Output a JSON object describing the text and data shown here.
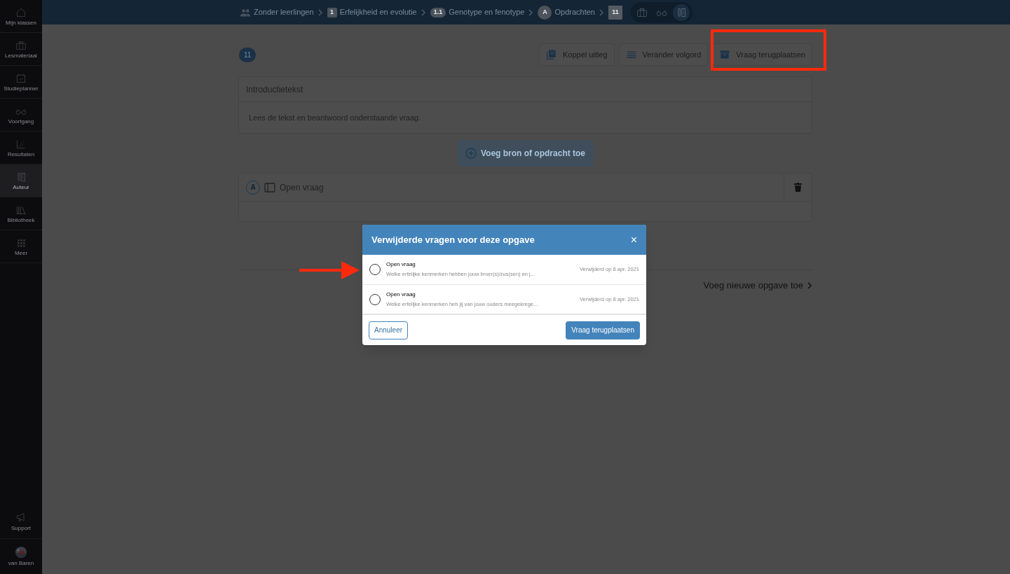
{
  "sidebar": {
    "items": [
      {
        "kind": "home",
        "label": "Mijn klassen",
        "selected": false
      },
      {
        "kind": "case",
        "label": "Lesmateriaal",
        "selected": false
      },
      {
        "kind": "calendar",
        "label": "Studieplanner",
        "selected": false
      },
      {
        "kind": "glasses",
        "label": "Voortgang",
        "selected": false
      },
      {
        "kind": "chart",
        "label": "Resultaten",
        "selected": false
      },
      {
        "kind": "author",
        "label": "Auteur",
        "selected": true
      },
      {
        "kind": "books",
        "label": "Bibliotheek",
        "selected": false
      },
      {
        "kind": "grid",
        "label": "Meer",
        "selected": false
      }
    ],
    "bottom_items": [
      {
        "kind": "megaphone",
        "label": "Support"
      },
      {
        "kind": "avatar",
        "label": "van Baren"
      }
    ]
  },
  "breadcrumb": [
    {
      "kind": "people",
      "label": "Zonder leerlingen"
    },
    {
      "kind": "square",
      "badge": "1",
      "label": "Erfelijkheid en evolutie"
    },
    {
      "kind": "pill",
      "badge": "1.1",
      "label": "Genotype en fenotype"
    },
    {
      "kind": "circle",
      "badge": "A",
      "label": "Opdrachten"
    },
    {
      "kind": "square",
      "badge": "11"
    }
  ],
  "view_toggles": [
    {
      "kind": "case",
      "selected": false
    },
    {
      "kind": "glasses",
      "selected": false
    },
    {
      "kind": "author",
      "selected": true
    }
  ],
  "page": {
    "count": "11",
    "toolbar": [
      {
        "kind": "book",
        "label": "Koppel uitleg"
      },
      {
        "kind": "list",
        "label": "Verander volgord"
      },
      {
        "kind": "archive",
        "label": "Vraag terugplaatsen"
      }
    ],
    "intro": {
      "title": "Introductietekst",
      "text": "Lees de tekst en beantwoord onderstaande vraag."
    },
    "add_button": "Voeg bron of opdracht toe",
    "question": {
      "badge": "A",
      "title": "Open vraag"
    },
    "add_exercise": "Voeg nieuwe opgave toe"
  },
  "modal": {
    "title": "Verwijderde vragen voor deze opgave",
    "close": "×",
    "items": [
      {
        "title": "Open vraag",
        "preview": "Welke erfelijke kenmerken hebben jouw broer(s)/zus(sen) en j...",
        "deleted": "Verwijderd op 8 apr. 2021",
        "selected": false
      },
      {
        "title": "Open vraag",
        "preview": "Welke erfelijke kenmerken heb jij van jouw ouders meegekrege...",
        "deleted": "Verwijderd op 8 apr. 2021",
        "selected": false
      }
    ],
    "cancel": "Annuleer",
    "confirm": "Vraag terugplaatsen"
  }
}
